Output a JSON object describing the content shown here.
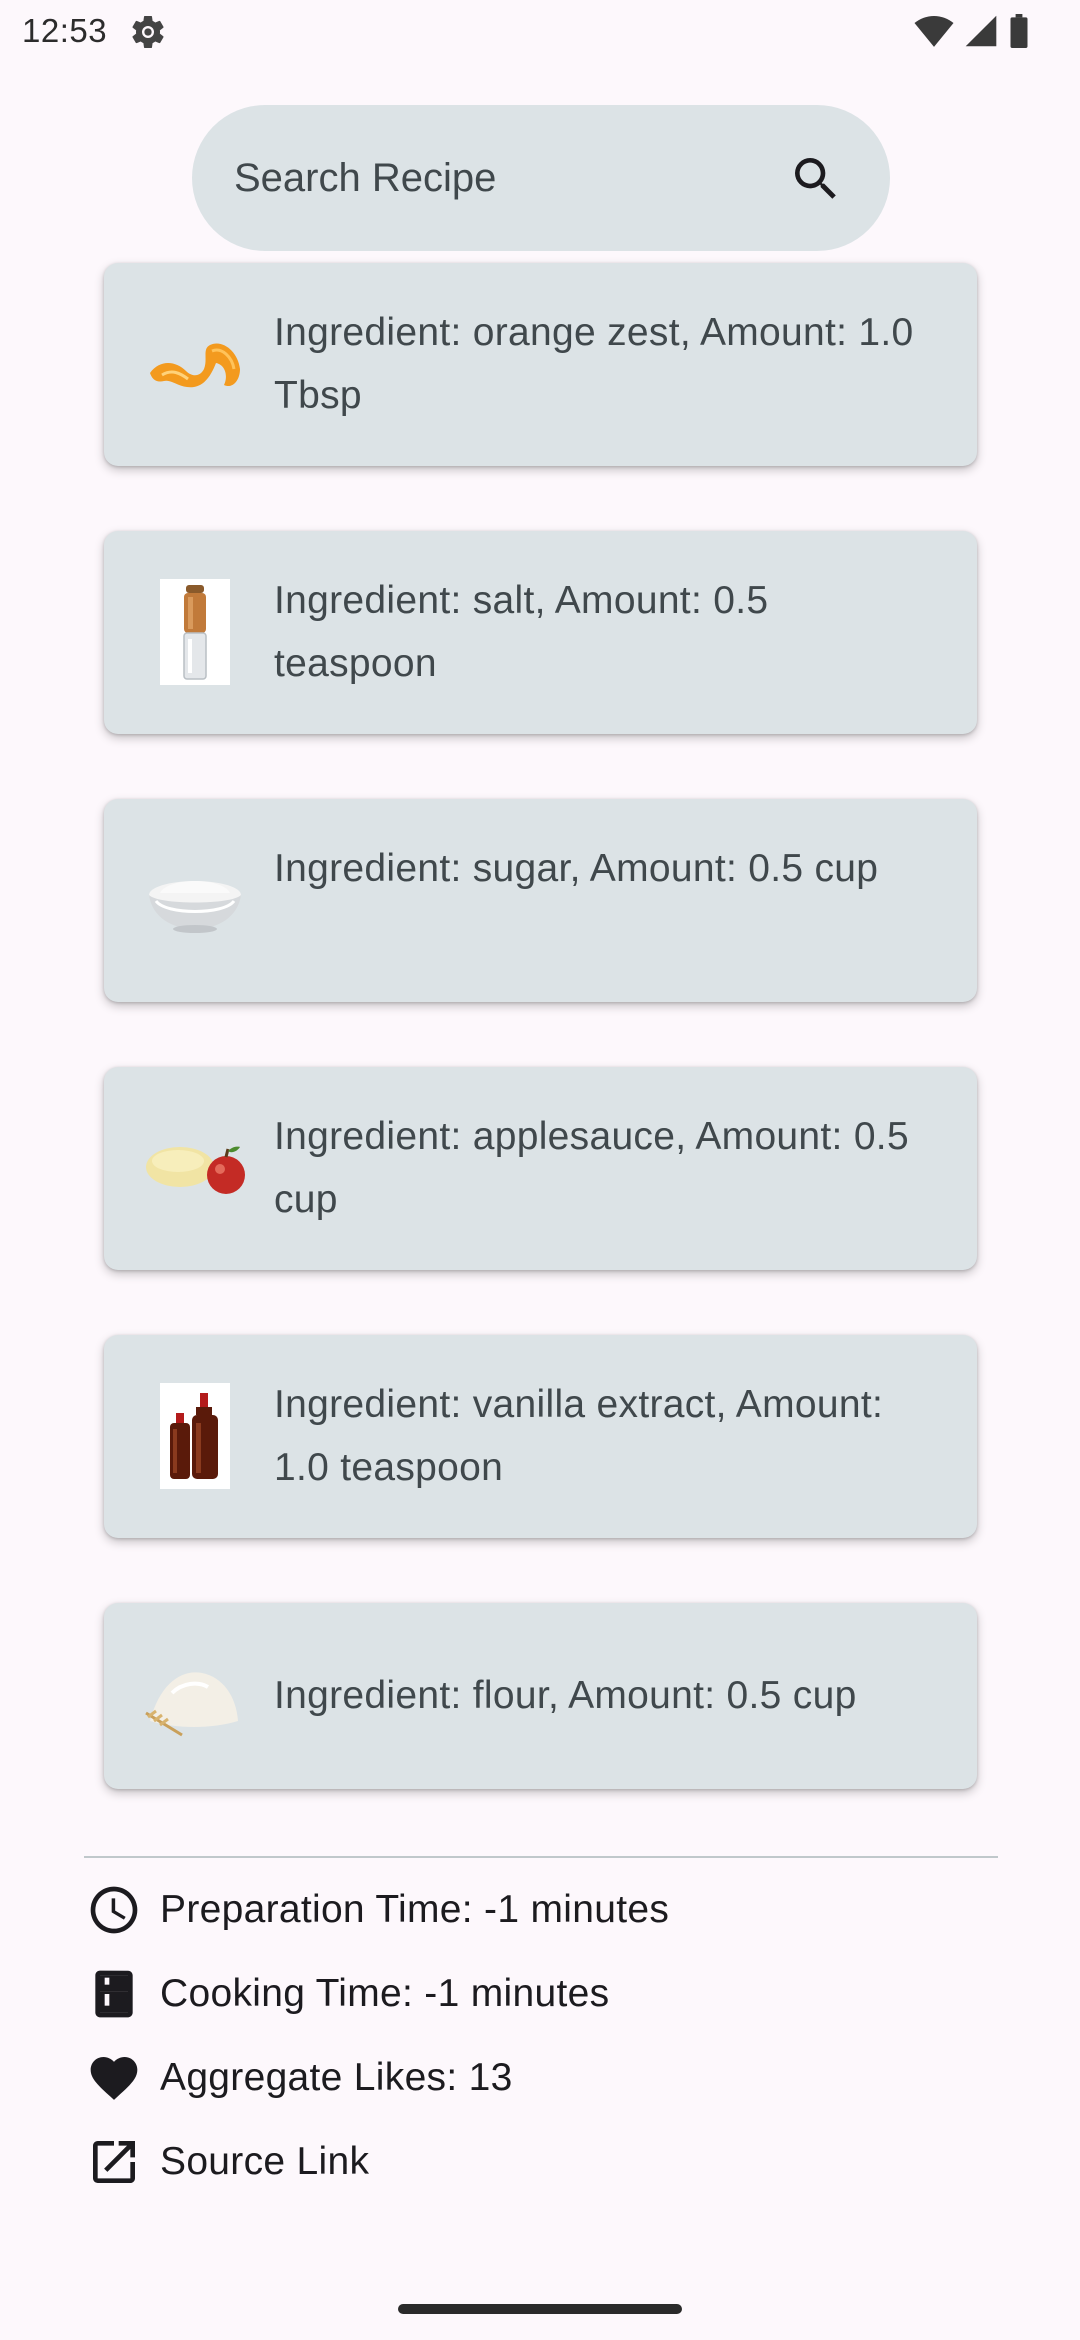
{
  "status_bar": {
    "time": "12:53",
    "icons": [
      "settings-gear-icon",
      "wifi-icon",
      "cell-signal-icon",
      "battery-icon"
    ]
  },
  "search": {
    "placeholder": "Search Recipe",
    "icon": "search-icon"
  },
  "ingredients": [
    {
      "text": "Ingredient: orange zest, Amount: 1.0 Tbsp",
      "image": "orange-zest"
    },
    {
      "text": "Ingredient: salt, Amount: 0.5 teaspoon",
      "image": "salt-grinder"
    },
    {
      "text": "Ingredient: sugar, Amount: 0.5 cup",
      "image": "sugar-bowl"
    },
    {
      "text": "Ingredient: applesauce, Amount: 0.5 cup",
      "image": "applesauce-apple"
    },
    {
      "text": "Ingredient: vanilla extract, Amount: 1.0 teaspoon",
      "image": "vanilla-bottles"
    },
    {
      "text": "Ingredient: flour, Amount: 0.5 cup",
      "image": "flour-pile"
    }
  ],
  "details": {
    "prep_time": "Preparation Time: -1 minutes",
    "cooking_time": "Cooking Time: -1 minutes",
    "likes": "Aggregate Likes: 13",
    "source_link": "Source Link"
  },
  "colors": {
    "background": "#fdf8fc",
    "card": "#dce3e6",
    "search_bar": "#dce3e6",
    "text_secondary": "#40484c",
    "text_primary": "#1c1b1f"
  }
}
